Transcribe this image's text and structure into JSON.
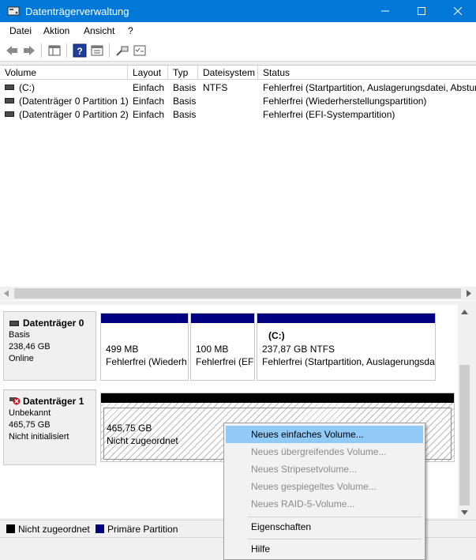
{
  "window": {
    "title": "Datenträgerverwaltung",
    "controls": [
      "minimize",
      "maximize",
      "close"
    ]
  },
  "menu": [
    "Datei",
    "Aktion",
    "Ansicht",
    "?"
  ],
  "toolbar_icons": [
    "back-arrow-icon",
    "forward-arrow-icon",
    "console-tree-icon",
    "help-icon",
    "properties-icon",
    "rescan-icon",
    "list-view-icon"
  ],
  "volume_list": {
    "columns": [
      "Volume",
      "Layout",
      "Typ",
      "Dateisystem",
      "Status"
    ],
    "rows": [
      {
        "volume": "(C:)",
        "layout": "Einfach",
        "type": "Basis",
        "fs": "NTFS",
        "status": "Fehlerfrei (Startpartition, Auslagerungsdatei, Absturzabbild, Primäre Partition)"
      },
      {
        "volume": "(Datenträger 0 Partition 1)",
        "layout": "Einfach",
        "type": "Basis",
        "fs": "",
        "status": "Fehlerfrei (Wiederherstellungspartition)"
      },
      {
        "volume": "(Datenträger 0 Partition 2)",
        "layout": "Einfach",
        "type": "Basis",
        "fs": "",
        "status": "Fehlerfrei (EFI-Systempartition)"
      }
    ]
  },
  "disks": [
    {
      "name": "Datenträger 0",
      "type": "Basis",
      "size": "238,46 GB",
      "status": "Online",
      "partitions": [
        {
          "label": "",
          "size": "499 MB",
          "status": "Fehlerfrei (Wiederh"
        },
        {
          "label": "",
          "size": "100 MB",
          "status": "Fehlerfrei (EF"
        },
        {
          "label": "(C:)",
          "size": "237,87 GB NTFS",
          "status": "Fehlerfrei (Startpartition, Auslagerungsda"
        }
      ]
    },
    {
      "name": "Datenträger 1",
      "type": "Unbekannt",
      "size": "465,75 GB",
      "status": "Nicht initialisiert",
      "partitions": [
        {
          "label": "",
          "size": "465,75 GB",
          "status": "Nicht zugeordnet"
        }
      ]
    }
  ],
  "legend": [
    {
      "label": "Nicht zugeordnet",
      "color": "#000000"
    },
    {
      "label": "Primäre Partition",
      "color": "#000080"
    }
  ],
  "context_menu": {
    "items": [
      {
        "label": "Neues einfaches Volume...",
        "enabled": true,
        "highlighted": true
      },
      {
        "label": "Neues übergreifendes Volume...",
        "enabled": false
      },
      {
        "label": "Neues Stripesetvolume...",
        "enabled": false
      },
      {
        "label": "Neues gespiegeltes Volume...",
        "enabled": false
      },
      {
        "label": "Neues RAID-5-Volume...",
        "enabled": false
      },
      {
        "label": "Eigenschaften",
        "enabled": true
      },
      {
        "label": "Hilfe",
        "enabled": true
      }
    ]
  },
  "colors": {
    "titlebar": "#0078d7",
    "primary_partition": "#000080",
    "unallocated": "#000000",
    "menu_highlight": "#91c9f7"
  }
}
